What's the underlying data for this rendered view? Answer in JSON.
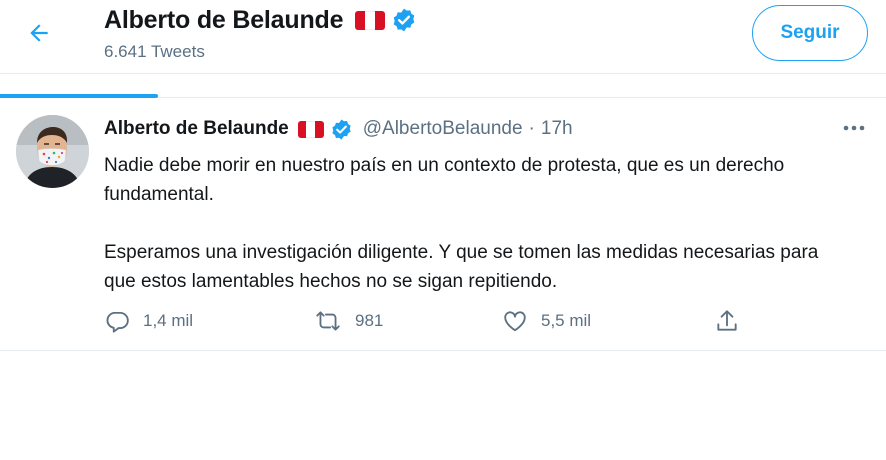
{
  "header": {
    "title": "Alberto de Belaunde",
    "subtitle": "6.641 Tweets",
    "follow_label": "Seguir",
    "back_icon": "arrow-left-icon",
    "accent_color": "#1da1f2"
  },
  "tweet": {
    "author": "Alberto de Belaunde",
    "handle": "@AlbertoBelaunde",
    "separator": "·",
    "time": "17h",
    "paragraph_1": "Nadie debe morir en nuestro país en un contexto de protesta, que es un derecho fundamental.",
    "paragraph_2": "Esperamos una investigación diligente. Y que se tomen las medidas necesarias para que estos lamentables hechos no se sigan repitiendo.",
    "actions": {
      "reply_count": "1,4 mil",
      "retweet_count": "981",
      "like_count": "5,5 mil"
    }
  },
  "colors": {
    "flag_red": "#d91023",
    "verified_blue": "#1da1f2",
    "muted_text": "#5b7083"
  }
}
